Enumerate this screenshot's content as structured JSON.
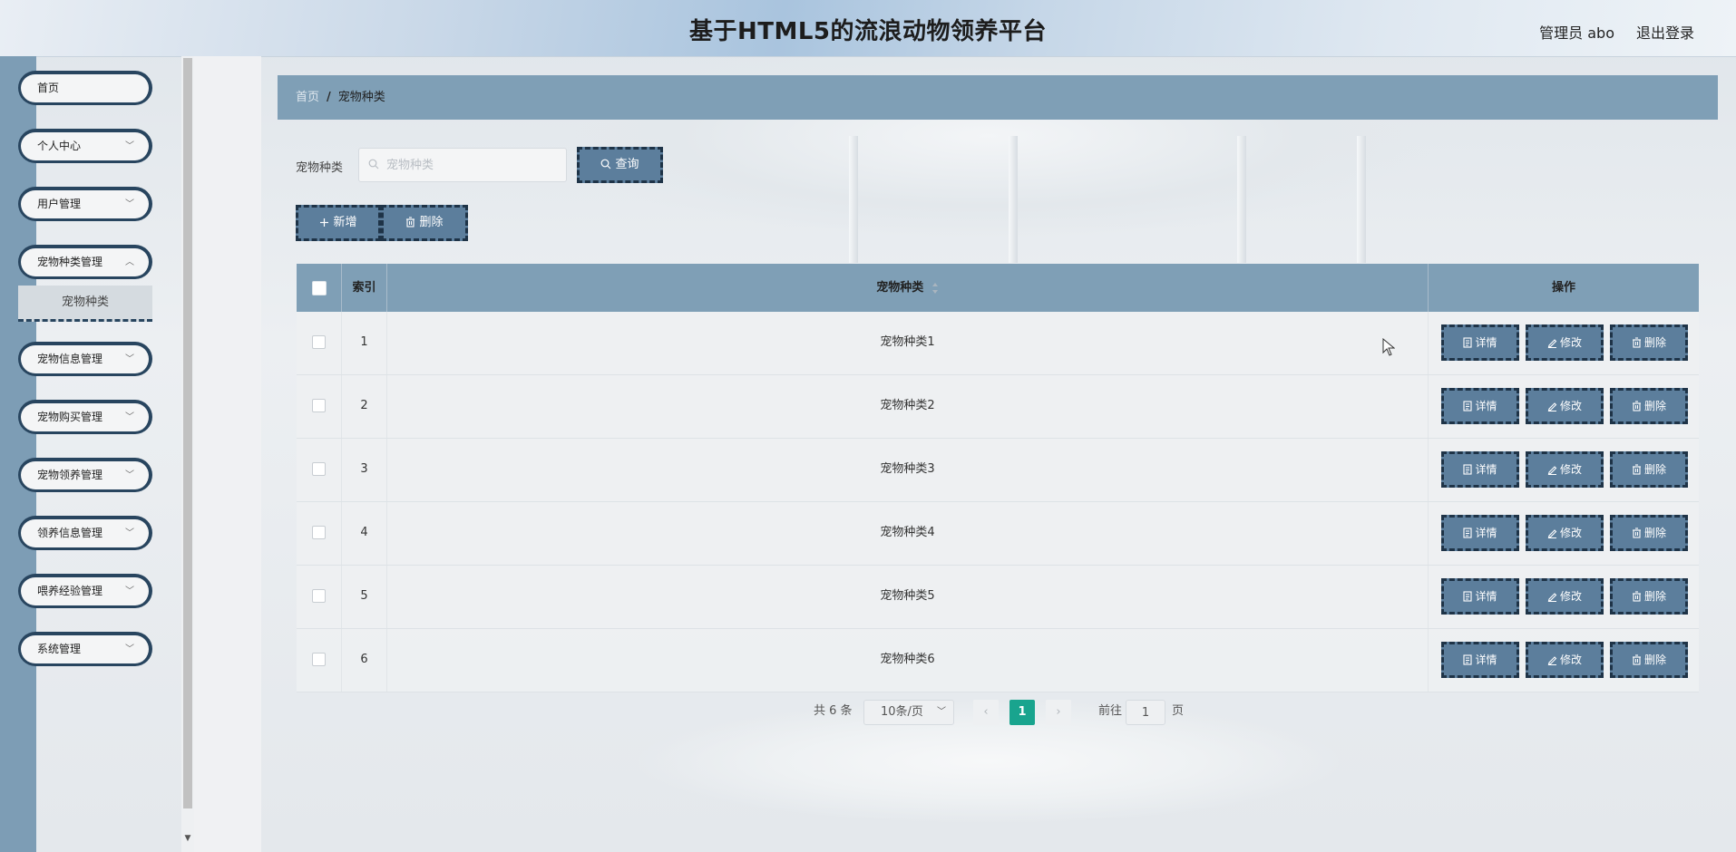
{
  "header": {
    "title": "基于HTML5的流浪动物领养平台",
    "user_label": "管理员 abo",
    "logout_label": "退出登录"
  },
  "sidebar": {
    "items": [
      {
        "label": "首页",
        "has_children": false
      },
      {
        "label": "个人中心",
        "has_children": true
      },
      {
        "label": "用户管理",
        "has_children": true
      },
      {
        "label": "宠物种类管理",
        "has_children": true
      },
      {
        "label": "宠物信息管理",
        "has_children": true
      },
      {
        "label": "宠物购买管理",
        "has_children": true
      },
      {
        "label": "宠物领养管理",
        "has_children": true
      },
      {
        "label": "领养信息管理",
        "has_children": true
      },
      {
        "label": "喂养经验管理",
        "has_children": true
      },
      {
        "label": "系统管理",
        "has_children": true
      }
    ],
    "submenu_active": "宠物种类"
  },
  "breadcrumb": {
    "home": "首页",
    "separator": "/",
    "current": "宠物种类"
  },
  "search": {
    "label": "宠物种类",
    "placeholder": "宠物种类",
    "value": "",
    "query_button": "查询"
  },
  "toolbar": {
    "add_label": "新增",
    "delete_label": "删除"
  },
  "table": {
    "headers": {
      "index": "索引",
      "type": "宠物种类",
      "ops": "操作"
    },
    "rows": [
      {
        "index": "1",
        "type": "宠物种类1"
      },
      {
        "index": "2",
        "type": "宠物种类2"
      },
      {
        "index": "3",
        "type": "宠物种类3"
      },
      {
        "index": "4",
        "type": "宠物种类4"
      },
      {
        "index": "5",
        "type": "宠物种类5"
      },
      {
        "index": "6",
        "type": "宠物种类6"
      }
    ],
    "op_labels": {
      "detail": "详情",
      "edit": "修改",
      "delete": "删除"
    }
  },
  "pagination": {
    "total_text": "共 6 条",
    "page_size": "10条/页",
    "prev": "‹",
    "next": "›",
    "current_page": "1",
    "goto_prefix": "前往",
    "goto_value": "1",
    "goto_suffix": "页"
  },
  "colors": {
    "accent_dark": "#28455f",
    "header_blue": "#7f9fb6",
    "button_fill": "#5c7e9c",
    "page_active": "#19a48e"
  }
}
